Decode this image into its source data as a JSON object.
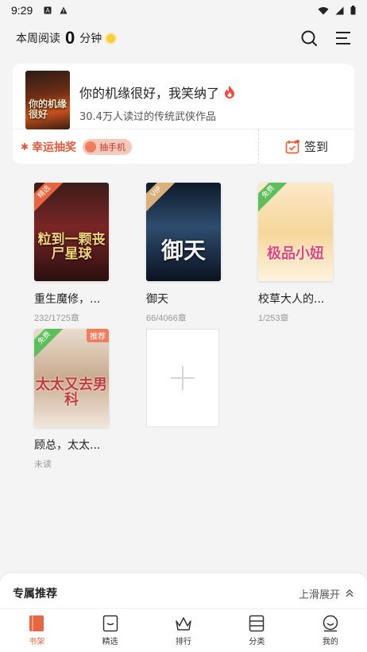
{
  "status_bar": {
    "time": "9:29"
  },
  "header": {
    "label_prefix": "本周阅读",
    "minutes": "0",
    "label_suffix": "分钟"
  },
  "featured": {
    "title": "你的机缘很好，我笑纳了",
    "subtitle": "30.4万人读过的传统武侠作品",
    "cover_text": "你的机缘很好",
    "lottery_label": "幸运抽奖",
    "badge_label": "抽手机",
    "checkin_label": "签到"
  },
  "books": [
    {
      "title": "重生魔修，...",
      "progress": "232/1725章",
      "ribbon": "精选",
      "cover_text": "粒到一颗丧尸星球",
      "ribbon_color": "#e8663f"
    },
    {
      "title": "御天",
      "progress": "66/4066章",
      "ribbon": "VIP",
      "cover_text": "御天",
      "ribbon_color": "#d8b27a"
    },
    {
      "title": "校草大人的...",
      "progress": "1/253章",
      "ribbon": "免费",
      "cover_text": "极品小妞",
      "ribbon_color": "#5cbf5c"
    },
    {
      "title": "顾总，太太...",
      "progress": "未读",
      "ribbon": "免费",
      "tag": "推荐",
      "cover_text": "太太又去男科",
      "ribbon_color": "#5cbf5c"
    }
  ],
  "sheet": {
    "title": "专属推荐",
    "expand_label": "上滑展开"
  },
  "nav": [
    {
      "label": "书架",
      "icon": "bookshelf-icon",
      "active": true
    },
    {
      "label": "精选",
      "icon": "featured-icon",
      "active": false
    },
    {
      "label": "排行",
      "icon": "ranking-icon",
      "active": false
    },
    {
      "label": "分类",
      "icon": "category-icon",
      "active": false
    },
    {
      "label": "我的",
      "icon": "profile-icon",
      "active": false
    }
  ],
  "colors": {
    "accent": "#e8663f",
    "lottery": "#e05a3a",
    "background": "#f4f4f4"
  }
}
